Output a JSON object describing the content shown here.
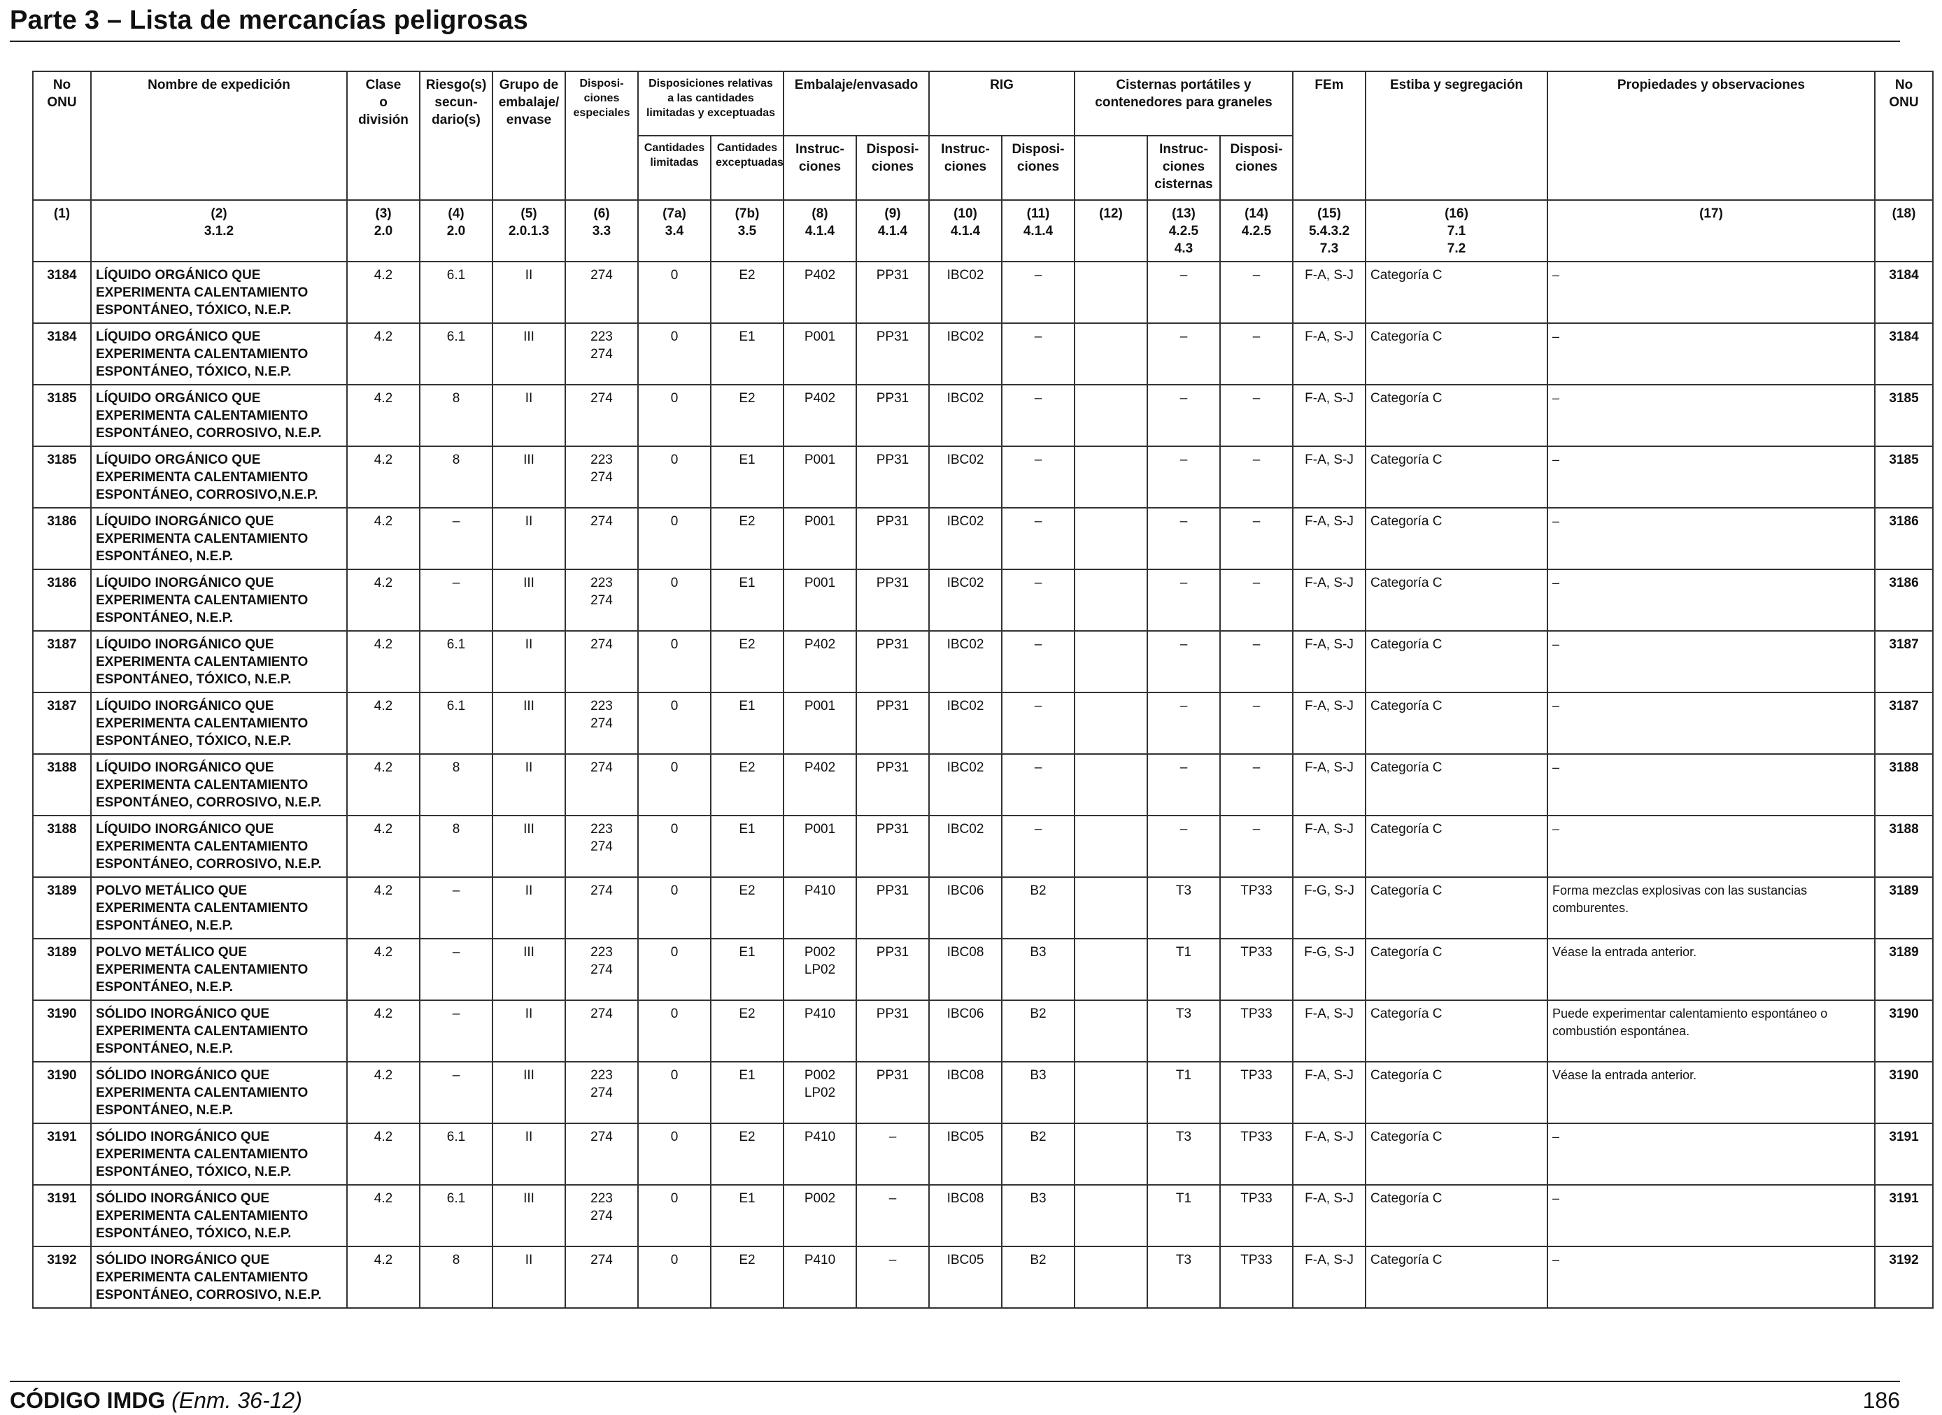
{
  "header": {
    "title": "Parte 3 – Lista de mercancías peligrosas"
  },
  "table": {
    "headers": {
      "no_onu": "No\nONU",
      "nombre": "Nombre de expedición",
      "clase": "Clase\no\ndivisión",
      "riesgo": "Riesgo(s)\nsecun-\ndario(s)",
      "grupo": "Grupo de\nembalaje/\nenvase",
      "disposiciones_especiales": "Disposi-\nciones\nespeciales",
      "cantidades_group": "Disposiciones relativas\na las cantidades\nlimitadas y exceptuadas",
      "cant_limitadas": "Cantidades\nlimitadas",
      "cant_exceptuadas": "Cantidades\nexceptuadas",
      "embalaje_group": "Embalaje/envasado",
      "emb_instrucciones": "Instruc-\nciones",
      "emb_disposiciones": "Disposi-\nciones",
      "rig_group": "RIG",
      "rig_instrucciones": "Instruc-\nciones",
      "rig_disposiciones": "Disposi-\nciones",
      "cisternas_group": "Cisternas portátiles y\ncontenedores para graneles",
      "cist_instrucciones": "Instruc-\nciones\ncisternas",
      "cist_disposiciones": "Disposi-\nciones",
      "fem": "FEm",
      "estiba": "Estiba y segregación",
      "propiedades": "Propiedades y observaciones",
      "no_onu_right": "No\nONU"
    },
    "column_refs": [
      "(1)",
      "(2)\n3.1.2",
      "(3)\n2.0",
      "(4)\n2.0",
      "(5)\n2.0.1.3",
      "(6)\n3.3",
      "(7a)\n3.4",
      "(7b)\n3.5",
      "(8)\n4.1.4",
      "(9)\n4.1.4",
      "(10)\n4.1.4",
      "(11)\n4.1.4",
      "(12)",
      "(13)\n4.2.5\n4.3",
      "(14)\n4.2.5",
      "(15)\n5.4.3.2\n7.3",
      "(16)\n7.1\n7.2",
      "(17)",
      "(18)"
    ],
    "rows": [
      {
        "un": "3184",
        "name": "LÍQUIDO ORGÁNICO QUE\nEXPERIMENTA CALENTAMIENTO\nESPONTÁNEO, TÓXICO, N.E.P.",
        "clase": "4.2",
        "riesgo": "6.1",
        "grupo": "II",
        "dispesp": "274",
        "limitadas": "0",
        "exceptuadas": "E2",
        "emb_instr": "P402",
        "emb_disp": "PP31",
        "rig_instr": "IBC02",
        "rig_disp": "–",
        "c12": "",
        "cist_instr": "–",
        "cist_disp": "–",
        "fem": "F-A, S-J",
        "estiba": "Categoría C",
        "obs": "–",
        "un_right": "3184"
      },
      {
        "un": "3184",
        "name": "LÍQUIDO ORGÁNICO QUE\nEXPERIMENTA CALENTAMIENTO\nESPONTÁNEO, TÓXICO, N.E.P.",
        "clase": "4.2",
        "riesgo": "6.1",
        "grupo": "III",
        "dispesp": "223\n274",
        "limitadas": "0",
        "exceptuadas": "E1",
        "emb_instr": "P001",
        "emb_disp": "PP31",
        "rig_instr": "IBC02",
        "rig_disp": "–",
        "c12": "",
        "cist_instr": "–",
        "cist_disp": "–",
        "fem": "F-A, S-J",
        "estiba": "Categoría C",
        "obs": "–",
        "un_right": "3184"
      },
      {
        "un": "3185",
        "name": "LÍQUIDO ORGÁNICO QUE\nEXPERIMENTA CALENTAMIENTO\nESPONTÁNEO, CORROSIVO, N.E.P.",
        "clase": "4.2",
        "riesgo": "8",
        "grupo": "II",
        "dispesp": "274",
        "limitadas": "0",
        "exceptuadas": "E2",
        "emb_instr": "P402",
        "emb_disp": "PP31",
        "rig_instr": "IBC02",
        "rig_disp": "–",
        "c12": "",
        "cist_instr": "–",
        "cist_disp": "–",
        "fem": "F-A, S-J",
        "estiba": "Categoría C",
        "obs": "–",
        "un_right": "3185"
      },
      {
        "un": "3185",
        "name": "LÍQUIDO ORGÁNICO QUE\nEXPERIMENTA CALENTAMIENTO\nESPONTÁNEO, CORROSIVO,N.E.P.",
        "clase": "4.2",
        "riesgo": "8",
        "grupo": "III",
        "dispesp": "223\n274",
        "limitadas": "0",
        "exceptuadas": "E1",
        "emb_instr": "P001",
        "emb_disp": "PP31",
        "rig_instr": "IBC02",
        "rig_disp": "–",
        "c12": "",
        "cist_instr": "–",
        "cist_disp": "–",
        "fem": "F-A, S-J",
        "estiba": "Categoría C",
        "obs": "–",
        "un_right": "3185"
      },
      {
        "un": "3186",
        "name": "LÍQUIDO INORGÁNICO QUE\nEXPERIMENTA CALENTAMIENTO\nESPONTÁNEO, N.E.P.",
        "clase": "4.2",
        "riesgo": "–",
        "grupo": "II",
        "dispesp": "274",
        "limitadas": "0",
        "exceptuadas": "E2",
        "emb_instr": "P001",
        "emb_disp": "PP31",
        "rig_instr": "IBC02",
        "rig_disp": "–",
        "c12": "",
        "cist_instr": "–",
        "cist_disp": "–",
        "fem": "F-A, S-J",
        "estiba": "Categoría C",
        "obs": "–",
        "un_right": "3186"
      },
      {
        "un": "3186",
        "name": "LÍQUIDO INORGÁNICO QUE\nEXPERIMENTA CALENTAMIENTO\nESPONTÁNEO, N.E.P.",
        "clase": "4.2",
        "riesgo": "–",
        "grupo": "III",
        "dispesp": "223\n274",
        "limitadas": "0",
        "exceptuadas": "E1",
        "emb_instr": "P001",
        "emb_disp": "PP31",
        "rig_instr": "IBC02",
        "rig_disp": "–",
        "c12": "",
        "cist_instr": "–",
        "cist_disp": "–",
        "fem": "F-A, S-J",
        "estiba": "Categoría C",
        "obs": "–",
        "un_right": "3186"
      },
      {
        "un": "3187",
        "name": "LÍQUIDO INORGÁNICO QUE\nEXPERIMENTA CALENTAMIENTO\nESPONTÁNEO, TÓXICO, N.E.P.",
        "clase": "4.2",
        "riesgo": "6.1",
        "grupo": "II",
        "dispesp": "274",
        "limitadas": "0",
        "exceptuadas": "E2",
        "emb_instr": "P402",
        "emb_disp": "PP31",
        "rig_instr": "IBC02",
        "rig_disp": "–",
        "c12": "",
        "cist_instr": "–",
        "cist_disp": "–",
        "fem": "F-A, S-J",
        "estiba": "Categoría C",
        "obs": "–",
        "un_right": "3187"
      },
      {
        "un": "3187",
        "name": "LÍQUIDO INORGÁNICO QUE\nEXPERIMENTA CALENTAMIENTO\nESPONTÁNEO, TÓXICO, N.E.P.",
        "clase": "4.2",
        "riesgo": "6.1",
        "grupo": "III",
        "dispesp": "223\n274",
        "limitadas": "0",
        "exceptuadas": "E1",
        "emb_instr": "P001",
        "emb_disp": "PP31",
        "rig_instr": "IBC02",
        "rig_disp": "–",
        "c12": "",
        "cist_instr": "–",
        "cist_disp": "–",
        "fem": "F-A, S-J",
        "estiba": "Categoría C",
        "obs": "–",
        "un_right": "3187"
      },
      {
        "un": "3188",
        "name": "LÍQUIDO INORGÁNICO QUE\nEXPERIMENTA CALENTAMIENTO\nESPONTÁNEO, CORROSIVO, N.E.P.",
        "clase": "4.2",
        "riesgo": "8",
        "grupo": "II",
        "dispesp": "274",
        "limitadas": "0",
        "exceptuadas": "E2",
        "emb_instr": "P402",
        "emb_disp": "PP31",
        "rig_instr": "IBC02",
        "rig_disp": "–",
        "c12": "",
        "cist_instr": "–",
        "cist_disp": "–",
        "fem": "F-A, S-J",
        "estiba": "Categoría C",
        "obs": "–",
        "un_right": "3188"
      },
      {
        "un": "3188",
        "name": "LÍQUIDO INORGÁNICO QUE\nEXPERIMENTA CALENTAMIENTO\nESPONTÁNEO, CORROSIVO, N.E.P.",
        "clase": "4.2",
        "riesgo": "8",
        "grupo": "III",
        "dispesp": "223\n274",
        "limitadas": "0",
        "exceptuadas": "E1",
        "emb_instr": "P001",
        "emb_disp": "PP31",
        "rig_instr": "IBC02",
        "rig_disp": "–",
        "c12": "",
        "cist_instr": "–",
        "cist_disp": "–",
        "fem": "F-A, S-J",
        "estiba": "Categoría C",
        "obs": "–",
        "un_right": "3188"
      },
      {
        "un": "3189",
        "name": "POLVO METÁLICO QUE\nEXPERIMENTA CALENTAMIENTO\nESPONTÁNEO, N.E.P.",
        "clase": "4.2",
        "riesgo": "–",
        "grupo": "II",
        "dispesp": "274",
        "limitadas": "0",
        "exceptuadas": "E2",
        "emb_instr": "P410",
        "emb_disp": "PP31",
        "rig_instr": "IBC06",
        "rig_disp": "B2",
        "c12": "",
        "cist_instr": "T3",
        "cist_disp": "TP33",
        "fem": "F-G, S-J",
        "estiba": "Categoría C",
        "obs": "Forma mezclas explosivas con las sustancias\ncomburentes.",
        "un_right": "3189"
      },
      {
        "un": "3189",
        "name": "POLVO METÁLICO QUE\nEXPERIMENTA CALENTAMIENTO\nESPONTÁNEO, N.E.P.",
        "clase": "4.2",
        "riesgo": "–",
        "grupo": "III",
        "dispesp": "223\n274",
        "limitadas": "0",
        "exceptuadas": "E1",
        "emb_instr": "P002\nLP02",
        "emb_disp": "PP31",
        "rig_instr": "IBC08",
        "rig_disp": "B3",
        "c12": "",
        "cist_instr": "T1",
        "cist_disp": "TP33",
        "fem": "F-G, S-J",
        "estiba": "Categoría C",
        "obs": "Véase la entrada anterior.",
        "un_right": "3189"
      },
      {
        "un": "3190",
        "name": "SÓLIDO INORGÁNICO QUE\nEXPERIMENTA CALENTAMIENTO\nESPONTÁNEO, N.E.P.",
        "clase": "4.2",
        "riesgo": "–",
        "grupo": "II",
        "dispesp": "274",
        "limitadas": "0",
        "exceptuadas": "E2",
        "emb_instr": "P410",
        "emb_disp": "PP31",
        "rig_instr": "IBC06",
        "rig_disp": "B2",
        "c12": "",
        "cist_instr": "T3",
        "cist_disp": "TP33",
        "fem": "F-A, S-J",
        "estiba": "Categoría C",
        "obs": "Puede experimentar calentamiento espontáneo o\ncombustión espontánea.",
        "un_right": "3190"
      },
      {
        "un": "3190",
        "name": "SÓLIDO INORGÁNICO QUE\nEXPERIMENTA CALENTAMIENTO\nESPONTÁNEO, N.E.P.",
        "clase": "4.2",
        "riesgo": "–",
        "grupo": "III",
        "dispesp": "223\n274",
        "limitadas": "0",
        "exceptuadas": "E1",
        "emb_instr": "P002\nLP02",
        "emb_disp": "PP31",
        "rig_instr": "IBC08",
        "rig_disp": "B3",
        "c12": "",
        "cist_instr": "T1",
        "cist_disp": "TP33",
        "fem": "F-A, S-J",
        "estiba": "Categoría C",
        "obs": "Véase la entrada anterior.",
        "un_right": "3190"
      },
      {
        "un": "3191",
        "name": "SÓLIDO INORGÁNICO QUE\nEXPERIMENTA CALENTAMIENTO\nESPONTÁNEO, TÓXICO, N.E.P.",
        "clase": "4.2",
        "riesgo": "6.1",
        "grupo": "II",
        "dispesp": "274",
        "limitadas": "0",
        "exceptuadas": "E2",
        "emb_instr": "P410",
        "emb_disp": "–",
        "rig_instr": "IBC05",
        "rig_disp": "B2",
        "c12": "",
        "cist_instr": "T3",
        "cist_disp": "TP33",
        "fem": "F-A, S-J",
        "estiba": "Categoría C",
        "obs": "–",
        "un_right": "3191"
      },
      {
        "un": "3191",
        "name": "SÓLIDO INORGÁNICO QUE\nEXPERIMENTA CALENTAMIENTO\nESPONTÁNEO, TÓXICO, N.E.P.",
        "clase": "4.2",
        "riesgo": "6.1",
        "grupo": "III",
        "dispesp": "223\n274",
        "limitadas": "0",
        "exceptuadas": "E1",
        "emb_instr": "P002",
        "emb_disp": "–",
        "rig_instr": "IBC08",
        "rig_disp": "B3",
        "c12": "",
        "cist_instr": "T1",
        "cist_disp": "TP33",
        "fem": "F-A, S-J",
        "estiba": "Categoría C",
        "obs": "–",
        "un_right": "3191"
      },
      {
        "un": "3192",
        "name": "SÓLIDO INORGÁNICO QUE\nEXPERIMENTA CALENTAMIENTO\nESPONTÁNEO, CORROSIVO, N.E.P.",
        "clase": "4.2",
        "riesgo": "8",
        "grupo": "II",
        "dispesp": "274",
        "limitadas": "0",
        "exceptuadas": "E2",
        "emb_instr": "P410",
        "emb_disp": "–",
        "rig_instr": "IBC05",
        "rig_disp": "B2",
        "c12": "",
        "cist_instr": "T3",
        "cist_disp": "TP33",
        "fem": "F-A, S-J",
        "estiba": "Categoría C",
        "obs": "–",
        "un_right": "3192"
      }
    ]
  },
  "footer": {
    "code": "CÓDIGO IMDG",
    "edition": "(Enm. 36-12)",
    "page_number": "186"
  }
}
